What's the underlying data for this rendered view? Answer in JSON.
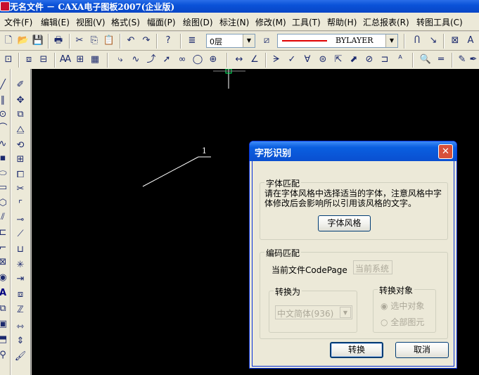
{
  "window": {
    "title": "无名文件 － CAXA电子图板2007(企业版)"
  },
  "menu": [
    "文件(F)",
    "编辑(E)",
    "视图(V)",
    "格式(S)",
    "幅面(P)",
    "绘图(D)",
    "标注(N)",
    "修改(M)",
    "工具(T)",
    "帮助(H)",
    "汇总报表(R)",
    "转图工具(C)"
  ],
  "toolbar": {
    "layer_value": "0层",
    "linetype_value": "BYLAYER",
    "linetype_color": "#e00000",
    "icons_row1": [
      "new-file",
      "open-folder",
      "save",
      "print",
      "cut",
      "copy",
      "paste",
      "undo",
      "redo",
      "help"
    ],
    "icons_row2": [
      "grid",
      "view-all",
      "view-window",
      "text-style",
      "table",
      "hatch",
      "line-style",
      "spline",
      "arc",
      "point-cross",
      "dimension",
      "angle-dim",
      "symbol",
      "leader"
    ]
  },
  "canvas": {
    "label": "1",
    "background": "#000000"
  },
  "dialog": {
    "title": "字形识别",
    "font_match": {
      "label": "字体匹配",
      "description": "请在字体风格中选择适当的字体，注意风格中字体修改后会影响所以引用该风格的文字。",
      "style_button": "字体风格"
    },
    "code_match": {
      "label": "编码匹配",
      "codepage_label": "当前文件CodePage",
      "codepage_value": "当前系统",
      "convert_to_label": "转换为",
      "convert_to_value": "中文简体(936)",
      "target_label": "转换对象",
      "option_selected": "选中对象",
      "option_all": "全部图元"
    },
    "convert_button": "转换",
    "cancel_button": "取消"
  }
}
